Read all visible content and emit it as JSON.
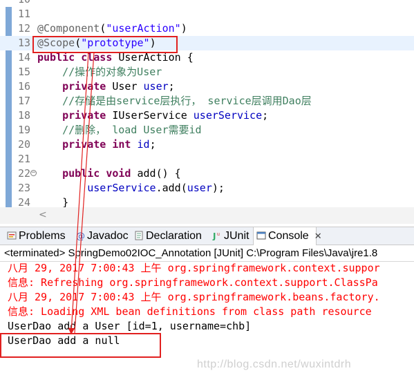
{
  "editor": {
    "lines": [
      {
        "num": "10",
        "tokens": []
      },
      {
        "num": "11",
        "tokens": []
      },
      {
        "num": "12",
        "tokens": [
          {
            "t": "ann",
            "v": "@Component"
          },
          {
            "t": "plain",
            "v": "("
          },
          {
            "t": "str",
            "v": "\"userAction\""
          },
          {
            "t": "plain",
            "v": ")"
          }
        ]
      },
      {
        "num": "13",
        "highlight": true,
        "tokens": [
          {
            "t": "ann",
            "v": "@Scope"
          },
          {
            "t": "plain",
            "v": "("
          },
          {
            "t": "str",
            "v": "\"prototype\""
          },
          {
            "t": "plain",
            "v": ")"
          }
        ]
      },
      {
        "num": "14",
        "tokens": [
          {
            "t": "kw",
            "v": "public"
          },
          {
            "t": "plain",
            "v": " "
          },
          {
            "t": "kw",
            "v": "class"
          },
          {
            "t": "plain",
            "v": " UserAction {"
          }
        ]
      },
      {
        "num": "15",
        "tokens": [
          {
            "t": "plain",
            "v": "    "
          },
          {
            "t": "cmt",
            "v": "//操作的对象为User"
          }
        ]
      },
      {
        "num": "16",
        "tokens": [
          {
            "t": "plain",
            "v": "    "
          },
          {
            "t": "kw",
            "v": "private"
          },
          {
            "t": "plain",
            "v": " User "
          },
          {
            "t": "fld",
            "v": "user"
          },
          {
            "t": "plain",
            "v": ";"
          }
        ]
      },
      {
        "num": "17",
        "tokens": [
          {
            "t": "plain",
            "v": "    "
          },
          {
            "t": "cmt",
            "v": "//存储是由service层执行， service层调用Dao层"
          }
        ]
      },
      {
        "num": "18",
        "tokens": [
          {
            "t": "plain",
            "v": "    "
          },
          {
            "t": "kw",
            "v": "private"
          },
          {
            "t": "plain",
            "v": " IUserService "
          },
          {
            "t": "fld",
            "v": "userService"
          },
          {
            "t": "plain",
            "v": ";"
          }
        ]
      },
      {
        "num": "19",
        "tokens": [
          {
            "t": "plain",
            "v": "    "
          },
          {
            "t": "cmt",
            "v": "//删除， load User需要id"
          }
        ]
      },
      {
        "num": "20",
        "tokens": [
          {
            "t": "plain",
            "v": "    "
          },
          {
            "t": "kw",
            "v": "private"
          },
          {
            "t": "plain",
            "v": " "
          },
          {
            "t": "kw",
            "v": "int"
          },
          {
            "t": "plain",
            "v": " "
          },
          {
            "t": "fld",
            "v": "id"
          },
          {
            "t": "plain",
            "v": ";"
          }
        ]
      },
      {
        "num": "21",
        "tokens": []
      },
      {
        "num": "22",
        "fold": true,
        "tokens": [
          {
            "t": "plain",
            "v": "    "
          },
          {
            "t": "kw",
            "v": "public"
          },
          {
            "t": "plain",
            "v": " "
          },
          {
            "t": "kw",
            "v": "void"
          },
          {
            "t": "plain",
            "v": " add() {"
          }
        ]
      },
      {
        "num": "23",
        "tokens": [
          {
            "t": "plain",
            "v": "        "
          },
          {
            "t": "fld",
            "v": "userService"
          },
          {
            "t": "plain",
            "v": ".add("
          },
          {
            "t": "fld",
            "v": "user"
          },
          {
            "t": "plain",
            "v": ");"
          }
        ]
      },
      {
        "num": "24",
        "tokens": [
          {
            "t": "plain",
            "v": "    }"
          }
        ]
      }
    ],
    "scroll_left_glyph": "<"
  },
  "tabs": [
    {
      "label": "Problems",
      "icon": "problems-icon",
      "active": false
    },
    {
      "label": "Javadoc",
      "icon": "javadoc-icon",
      "active": false
    },
    {
      "label": "Declaration",
      "icon": "declaration-icon",
      "active": false
    },
    {
      "label": "JUnit",
      "icon": "junit-icon",
      "active": false
    },
    {
      "label": "Console",
      "icon": "console-icon",
      "active": true,
      "close": "✕"
    }
  ],
  "console": {
    "header": "<terminated> SpringDemo02IOC_Annotation [JUnit] C:\\Program Files\\Java\\jre1.8",
    "lines": [
      {
        "style": "err",
        "text": "八月 29, 2017 7:00:43 上午 org.springframework.context.suppor"
      },
      {
        "style": "err",
        "text": "信息: Refreshing org.springframework.context.support.ClassPa"
      },
      {
        "style": "err",
        "text": "八月 29, 2017 7:00:43 上午 org.springframework.beans.factory."
      },
      {
        "style": "err",
        "text": "信息: Loading XML bean definitions from class path resource"
      },
      {
        "style": "out",
        "text": "UserDao add a User [id=1, username=chb]"
      },
      {
        "style": "out",
        "text": "UserDao add a null"
      }
    ],
    "watermark": "http://blog.csdn.net/wuxintdrh"
  },
  "colors": {
    "keyword": "#7f0055",
    "string": "#2a00ff",
    "field": "#0000c0",
    "comment": "#3f7f5f",
    "annotation": "#646464",
    "stderr": "#ff0000",
    "highlight_box": "#e1201f"
  }
}
